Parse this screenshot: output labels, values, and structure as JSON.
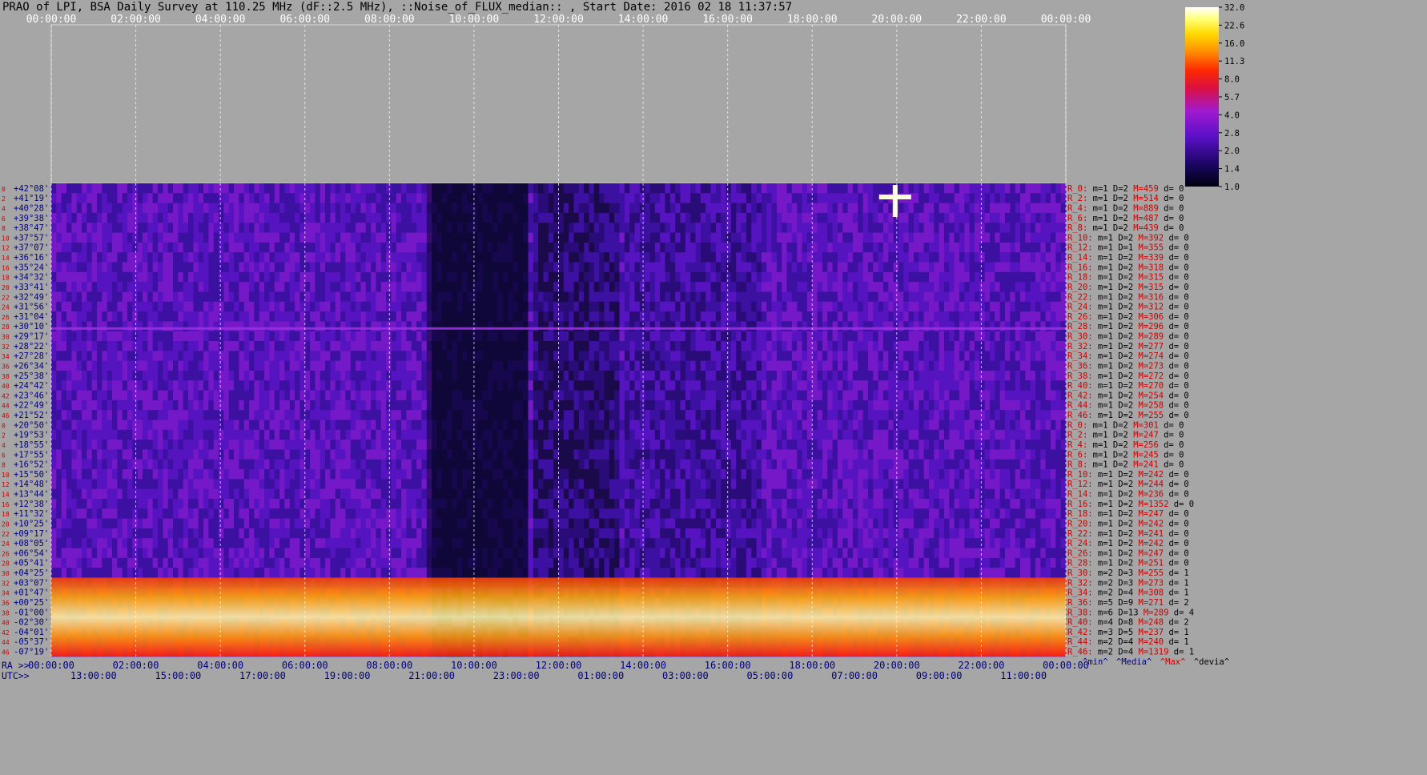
{
  "title": "PRAO of LPI, BSA Daily Survey at 110.25 MHz (dF::2.5 MHz), ::Noise_of_FLUX_median:: , Start Date: 2016 02 18 11:37:57",
  "colors": {
    "background": "#a6a6a6",
    "dec_label": "#00007a",
    "row_index": "#cc0000",
    "stat_beam": "#cc0000",
    "stat_text": "#000000",
    "grid": "#ffffff"
  },
  "chart_data": {
    "type": "heatmap",
    "title": "PRAO of LPI, BSA Daily Survey at 110.25 MHz (dF::2.5 MHz), ::Noise_of_FLUX_median:: , Start Date: 2016 02 18 11:37:57",
    "colormap": "black-purple-red-yellow-white",
    "x_top_ticks": [
      "00:00:00",
      "02:00:00",
      "04:00:00",
      "06:00:00",
      "08:00:00",
      "10:00:00",
      "12:00:00",
      "14:00:00",
      "16:00:00",
      "18:00:00",
      "20:00:00",
      "22:00:00",
      "00:00:00"
    ],
    "x_ra_label": "RA >>",
    "x_ra_ticks": [
      "00:00:00",
      "02:00:00",
      "04:00:00",
      "06:00:00",
      "08:00:00",
      "10:00:00",
      "12:00:00",
      "14:00:00",
      "16:00:00",
      "18:00:00",
      "20:00:00",
      "22:00:00",
      "00:00:00"
    ],
    "x_utc_label": "UTC>>",
    "x_utc_ticks": [
      "13:00:00",
      "15:00:00",
      "17:00:00",
      "19:00:00",
      "21:00:00",
      "23:00:00",
      "01:00:00",
      "03:00:00",
      "05:00:00",
      "07:00:00",
      "09:00:00",
      "11:00:00"
    ],
    "y_row_index": [
      "0",
      "2",
      "4",
      "6",
      "8",
      "10",
      "12",
      "14",
      "16",
      "18",
      "20",
      "22",
      "24",
      "26",
      "28",
      "30",
      "32",
      "34",
      "36",
      "38",
      "40",
      "42",
      "44",
      "46",
      "0",
      "2",
      "4",
      "6",
      "8",
      "10",
      "12",
      "14",
      "16",
      "18",
      "20",
      "22",
      "24",
      "26",
      "28",
      "30",
      "32",
      "34",
      "36",
      "38",
      "40",
      "42",
      "44",
      "46"
    ],
    "y_dec_labels": [
      "+42°08'",
      "+41°19'",
      "+40°28'",
      "+39°38'",
      "+38°47'",
      "+37°57'",
      "+37°07'",
      "+36°16'",
      "+35°24'",
      "+34°32'",
      "+33°41'",
      "+32°49'",
      "+31°56'",
      "+31°04'",
      "+30°10'",
      "+29°17'",
      "+28°22'",
      "+27°28'",
      "+26°34'",
      "+25°38'",
      "+24°42'",
      "+23°46'",
      "+22°49'",
      "+21°52'",
      "+20°50'",
      "+19°53'",
      "+18°55'",
      "+17°55'",
      "+16°52'",
      "+15°50'",
      "+14°48'",
      "+13°44'",
      "+12°38'",
      "+11°32'",
      "+10°25'",
      "+09°17'",
      "+08°05'",
      "+06°54'",
      "+05°41'",
      "+04°25'",
      "+03°07'",
      "+01°47'",
      "+00°25'",
      "-01°00'",
      "-02°30'",
      "-04°01'",
      "-05°37'",
      "-07°19'"
    ],
    "beam_stats": [
      {
        "beam": "R_0:",
        "m": "m=1",
        "D": "D=2",
        "M": "M=459",
        "d": "d= 0"
      },
      {
        "beam": "R_2:",
        "m": "m=1",
        "D": "D=2",
        "M": "M=514",
        "d": "d= 0"
      },
      {
        "beam": "R_4:",
        "m": "m=1",
        "D": "D=2",
        "M": "M=889",
        "d": "d= 0"
      },
      {
        "beam": "R_6:",
        "m": "m=1",
        "D": "D=2",
        "M": "M=487",
        "d": "d= 0"
      },
      {
        "beam": "R_8:",
        "m": "m=1",
        "D": "D=2",
        "M": "M=439",
        "d": "d= 0"
      },
      {
        "beam": "R_10:",
        "m": "m=1",
        "D": "D=2",
        "M": "M=392",
        "d": "d= 0"
      },
      {
        "beam": "R_12:",
        "m": "m=1",
        "D": "D=1",
        "M": "M=355",
        "d": "d= 0"
      },
      {
        "beam": "R_14:",
        "m": "m=1",
        "D": "D=2",
        "M": "M=339",
        "d": "d= 0"
      },
      {
        "beam": "R_16:",
        "m": "m=1",
        "D": "D=2",
        "M": "M=318",
        "d": "d= 0"
      },
      {
        "beam": "R_18:",
        "m": "m=1",
        "D": "D=2",
        "M": "M=315",
        "d": "d= 0"
      },
      {
        "beam": "R_20:",
        "m": "m=1",
        "D": "D=2",
        "M": "M=315",
        "d": "d= 0"
      },
      {
        "beam": "R_22:",
        "m": "m=1",
        "D": "D=2",
        "M": "M=316",
        "d": "d= 0"
      },
      {
        "beam": "R_24:",
        "m": "m=1",
        "D": "D=2",
        "M": "M=312",
        "d": "d= 0"
      },
      {
        "beam": "R_26:",
        "m": "m=1",
        "D": "D=2",
        "M": "M=306",
        "d": "d= 0"
      },
      {
        "beam": "R_28:",
        "m": "m=1",
        "D": "D=2",
        "M": "M=296",
        "d": "d= 0"
      },
      {
        "beam": "R_30:",
        "m": "m=1",
        "D": "D=2",
        "M": "M=289",
        "d": "d= 0"
      },
      {
        "beam": "R_32:",
        "m": "m=1",
        "D": "D=2",
        "M": "M=277",
        "d": "d= 0"
      },
      {
        "beam": "R_34:",
        "m": "m=1",
        "D": "D=2",
        "M": "M=274",
        "d": "d= 0"
      },
      {
        "beam": "R_36:",
        "m": "m=1",
        "D": "D=2",
        "M": "M=273",
        "d": "d= 0"
      },
      {
        "beam": "R_38:",
        "m": "m=1",
        "D": "D=2",
        "M": "M=272",
        "d": "d= 0"
      },
      {
        "beam": "R_40:",
        "m": "m=1",
        "D": "D=2",
        "M": "M=270",
        "d": "d= 0"
      },
      {
        "beam": "R_42:",
        "m": "m=1",
        "D": "D=2",
        "M": "M=254",
        "d": "d= 0"
      },
      {
        "beam": "R_44:",
        "m": "m=1",
        "D": "D=2",
        "M": "M=258",
        "d": "d= 0"
      },
      {
        "beam": "R_46:",
        "m": "m=1",
        "D": "D=2",
        "M": "M=255",
        "d": "d= 0"
      },
      {
        "beam": "R_0:",
        "m": "m=1",
        "D": "D=2",
        "M": "M=301",
        "d": "d= 0"
      },
      {
        "beam": "R_2:",
        "m": "m=1",
        "D": "D=2",
        "M": "M=247",
        "d": "d= 0"
      },
      {
        "beam": "R_4:",
        "m": "m=1",
        "D": "D=2",
        "M": "M=256",
        "d": "d= 0"
      },
      {
        "beam": "R_6:",
        "m": "m=1",
        "D": "D=2",
        "M": "M=245",
        "d": "d= 0"
      },
      {
        "beam": "R_8:",
        "m": "m=1",
        "D": "D=2",
        "M": "M=241",
        "d": "d= 0"
      },
      {
        "beam": "R_10:",
        "m": "m=1",
        "D": "D=2",
        "M": "M=242",
        "d": "d= 0"
      },
      {
        "beam": "R_12:",
        "m": "m=1",
        "D": "D=2",
        "M": "M=244",
        "d": "d= 0"
      },
      {
        "beam": "R_14:",
        "m": "m=1",
        "D": "D=2",
        "M": "M=236",
        "d": "d= 0"
      },
      {
        "beam": "R_16:",
        "m": "m=1",
        "D": "D=2",
        "M": "M=1352",
        "d": "d= 0"
      },
      {
        "beam": "R_18:",
        "m": "m=1",
        "D": "D=2",
        "M": "M=247",
        "d": "d= 0"
      },
      {
        "beam": "R_20:",
        "m": "m=1",
        "D": "D=2",
        "M": "M=242",
        "d": "d= 0"
      },
      {
        "beam": "R_22:",
        "m": "m=1",
        "D": "D=2",
        "M": "M=241",
        "d": "d= 0"
      },
      {
        "beam": "R_24:",
        "m": "m=1",
        "D": "D=2",
        "M": "M=242",
        "d": "d= 0"
      },
      {
        "beam": "R_26:",
        "m": "m=1",
        "D": "D=2",
        "M": "M=247",
        "d": "d= 0"
      },
      {
        "beam": "R_28:",
        "m": "m=1",
        "D": "D=2",
        "M": "M=251",
        "d": "d= 0"
      },
      {
        "beam": "R_30:",
        "m": "m=2",
        "D": "D=3",
        "M": "M=255",
        "d": "d= 1"
      },
      {
        "beam": "R_32:",
        "m": "m=2",
        "D": "D=3",
        "M": "M=273",
        "d": "d= 1"
      },
      {
        "beam": "R_34:",
        "m": "m=2",
        "D": "D=4",
        "M": "M=308",
        "d": "d= 1"
      },
      {
        "beam": "R_36:",
        "m": "m=5",
        "D": "D=9",
        "M": "M=271",
        "d": "d= 2"
      },
      {
        "beam": "R_38:",
        "m": "m=6",
        "D": "D=13",
        "M": "M=289",
        "d": "d= 4"
      },
      {
        "beam": "R_40:",
        "m": "m=4",
        "D": "D=8",
        "M": "M=248",
        "d": "d= 2"
      },
      {
        "beam": "R_42:",
        "m": "m=3",
        "D": "D=5",
        "M": "M=237",
        "d": "d= 1"
      },
      {
        "beam": "R_44:",
        "m": "m=2",
        "D": "D=4",
        "M": "M=240",
        "d": "d= 1"
      },
      {
        "beam": "R_46:",
        "m": "m=2",
        "D": "D=4",
        "M": "M=1319",
        "d": "d= 1"
      }
    ],
    "stat_legend": [
      "^min^",
      "^Media^",
      "^Max^",
      "^devia^"
    ],
    "colorbar": {
      "ticks": [
        "32.0",
        "22.6",
        "16.0",
        "11.3",
        "8.0",
        "5.7",
        "4.0",
        "2.8",
        "2.0",
        "1.4",
        "1.0"
      ],
      "scale": "log",
      "range": [
        1.0,
        32.0
      ]
    }
  }
}
